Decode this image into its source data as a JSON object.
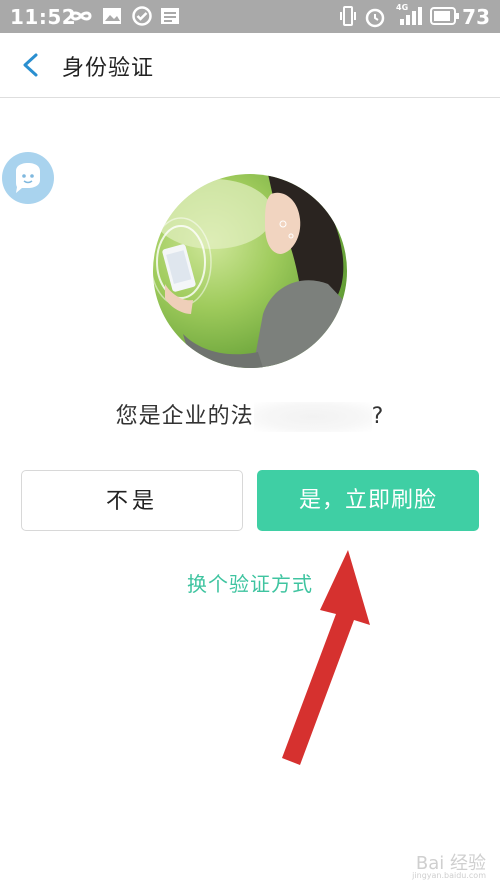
{
  "status_bar": {
    "time": "11:52",
    "battery": "73",
    "icons": [
      "infinity-icon",
      "image-icon",
      "check-circle-icon",
      "news-icon",
      "vibrate-icon",
      "alarm-icon",
      "signal-4g-icon",
      "battery-icon"
    ],
    "signal_label": "4G"
  },
  "header": {
    "title": "身份验证",
    "accent_color": "#2a8fd0"
  },
  "question": {
    "prefix": "您是企业的法",
    "suffix": "?"
  },
  "buttons": {
    "no_label": "不是",
    "yes_label": "是，立即刷脸",
    "yes_color": "#3fcfa4"
  },
  "switch_link": "换个验证方式",
  "watermark": {
    "brand": "Bai 经验",
    "url": "jingyan.baidu.com"
  }
}
